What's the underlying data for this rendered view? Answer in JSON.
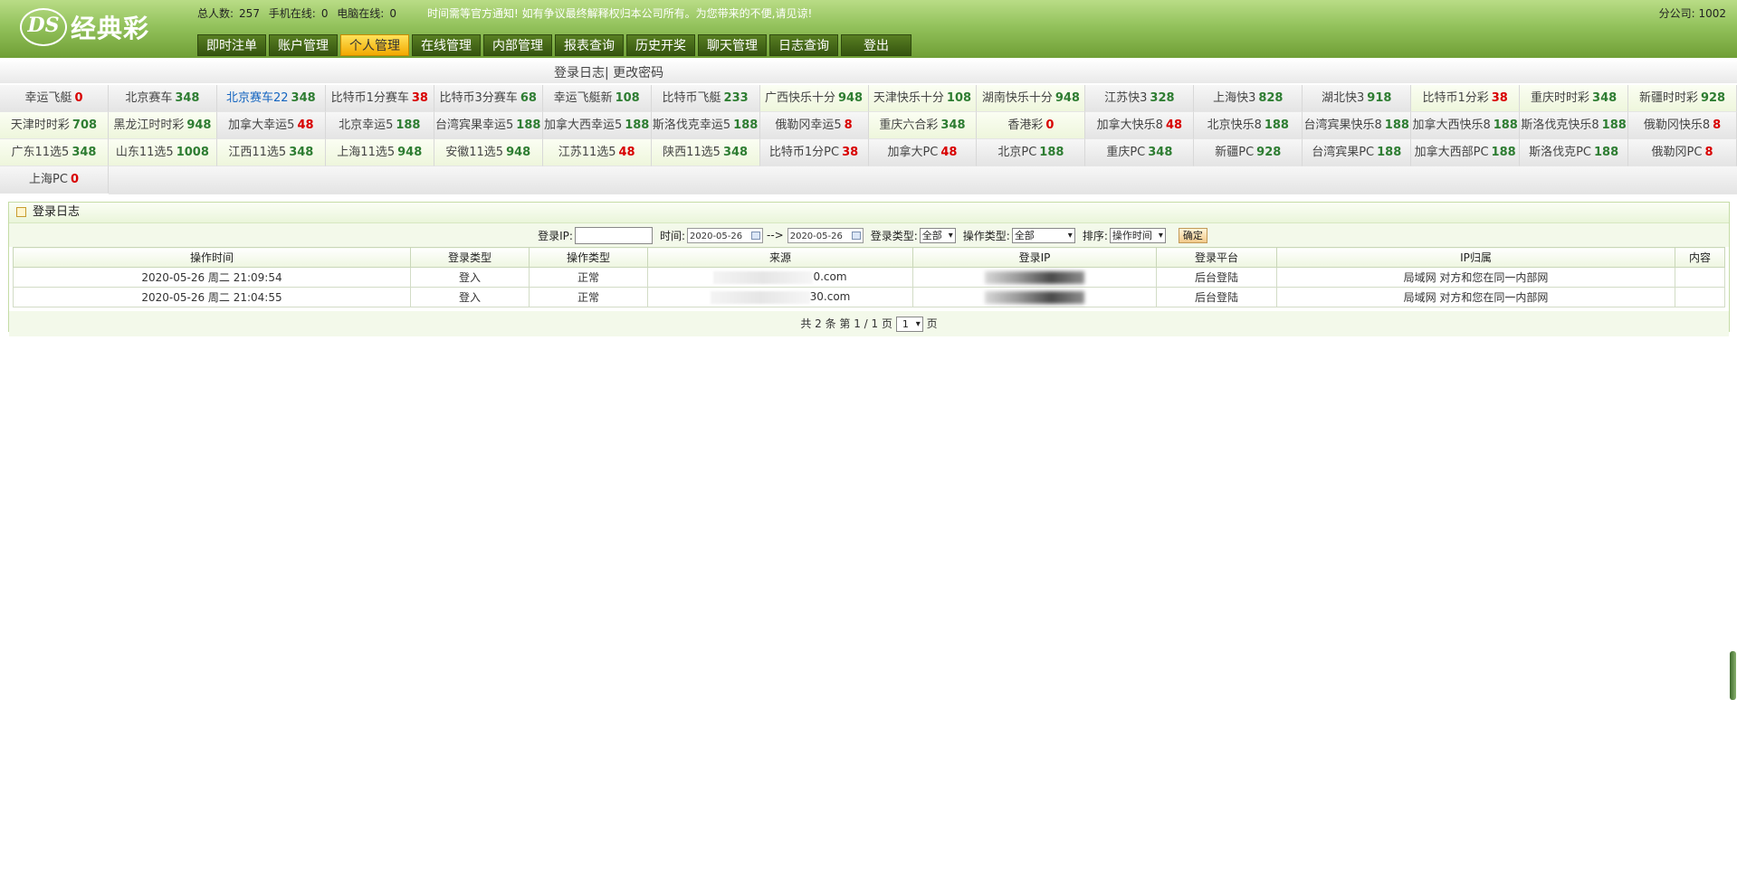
{
  "header": {
    "logo_mark": "DS",
    "logo_text": "经典彩",
    "stats": {
      "total_label": "总人数:",
      "total": "257",
      "mobile_label": "手机在线:",
      "mobile": "0",
      "pc_label": "电脑在线:",
      "pc": "0"
    },
    "notice": "时间需等官方通知! 如有争议最终解释权归本公司所有。为您带来的不便,请见谅!",
    "company": "分公司: 1002",
    "nav": [
      "即时注单",
      "账户管理",
      "个人管理",
      "在线管理",
      "内部管理",
      "报表查询",
      "历史开奖",
      "聊天管理",
      "日志查询",
      "登出"
    ],
    "active_nav": "个人管理"
  },
  "subnav": {
    "login_log": "登录日志",
    "sep": "|",
    "change_pwd": "更改密码"
  },
  "lottery": [
    [
      {
        "name": "幸运飞艇",
        "num": "0",
        "color": "red"
      },
      {
        "name": "北京赛车",
        "num": "348",
        "color": "green"
      },
      {
        "name": "北京赛车22",
        "num": "348",
        "color": "green",
        "name_color": "blue"
      },
      {
        "name": "比特币1分赛车",
        "num": "38",
        "color": "red"
      },
      {
        "name": "比特币3分赛车",
        "num": "68",
        "color": "green"
      },
      {
        "name": "幸运飞艇新",
        "num": "108",
        "color": "green"
      },
      {
        "name": "比特币飞艇",
        "num": "233",
        "color": "green"
      },
      {
        "name": "广西快乐十分",
        "num": "948",
        "color": "green",
        "bg": "g"
      },
      {
        "name": "天津快乐十分",
        "num": "108",
        "color": "green",
        "bg": "g"
      },
      {
        "name": "湖南快乐十分",
        "num": "948",
        "color": "green",
        "bg": "g"
      },
      {
        "name": "江苏快3",
        "num": "328",
        "color": "green"
      },
      {
        "name": "上海快3",
        "num": "828",
        "color": "green"
      },
      {
        "name": "湖北快3",
        "num": "918",
        "color": "green"
      },
      {
        "name": "比特币1分彩",
        "num": "38",
        "color": "red",
        "bg": "g"
      },
      {
        "name": "重庆时时彩",
        "num": "348",
        "color": "green",
        "bg": "g"
      },
      {
        "name": "新疆时时彩",
        "num": "928",
        "color": "green",
        "bg": "g"
      }
    ],
    [
      {
        "name": "天津时时彩",
        "num": "708",
        "color": "green",
        "bg": "g"
      },
      {
        "name": "黑龙江时时彩",
        "num": "948",
        "color": "green",
        "bg": "g"
      },
      {
        "name": "加拿大幸运5",
        "num": "48",
        "color": "red"
      },
      {
        "name": "北京幸运5",
        "num": "188",
        "color": "green"
      },
      {
        "name": "台湾宾果幸运5",
        "num": "188",
        "color": "green"
      },
      {
        "name": "加拿大西幸运5",
        "num": "188",
        "color": "green"
      },
      {
        "name": "斯洛伐克幸运5",
        "num": "188",
        "color": "green"
      },
      {
        "name": "俄勒冈幸运5",
        "num": "8",
        "color": "red"
      },
      {
        "name": "重庆六合彩",
        "num": "348",
        "color": "green",
        "bg": "g"
      },
      {
        "name": "香港彩",
        "num": "0",
        "color": "red",
        "bg": "g"
      },
      {
        "name": "加拿大快乐8",
        "num": "48",
        "color": "red"
      },
      {
        "name": "北京快乐8",
        "num": "188",
        "color": "green"
      },
      {
        "name": "台湾宾果快乐8",
        "num": "188",
        "color": "green"
      },
      {
        "name": "加拿大西快乐8",
        "num": "188",
        "color": "green"
      },
      {
        "name": "斯洛伐克快乐8",
        "num": "188",
        "color": "green"
      },
      {
        "name": "俄勒冈快乐8",
        "num": "8",
        "color": "red"
      }
    ],
    [
      {
        "name": "广东11选5",
        "num": "348",
        "color": "green",
        "bg": "g"
      },
      {
        "name": "山东11选5",
        "num": "1008",
        "color": "green",
        "bg": "g"
      },
      {
        "name": "江西11选5",
        "num": "348",
        "color": "green",
        "bg": "g"
      },
      {
        "name": "上海11选5",
        "num": "948",
        "color": "green",
        "bg": "g"
      },
      {
        "name": "安徽11选5",
        "num": "948",
        "color": "green",
        "bg": "g"
      },
      {
        "name": "江苏11选5",
        "num": "48",
        "color": "red",
        "bg": "g"
      },
      {
        "name": "陕西11选5",
        "num": "348",
        "color": "green",
        "bg": "g"
      },
      {
        "name": "比特币1分PC",
        "num": "38",
        "color": "red"
      },
      {
        "name": "加拿大PC",
        "num": "48",
        "color": "red"
      },
      {
        "name": "北京PC",
        "num": "188",
        "color": "green"
      },
      {
        "name": "重庆PC",
        "num": "348",
        "color": "green"
      },
      {
        "name": "新疆PC",
        "num": "928",
        "color": "green"
      },
      {
        "name": "台湾宾果PC",
        "num": "188",
        "color": "green"
      },
      {
        "name": "加拿大西部PC",
        "num": "188",
        "color": "green"
      },
      {
        "name": "斯洛伐克PC",
        "num": "188",
        "color": "green"
      },
      {
        "name": "俄勒冈PC",
        "num": "8",
        "color": "red"
      }
    ],
    [
      {
        "name": "上海PC",
        "num": "0",
        "color": "red"
      }
    ]
  ],
  "panel": {
    "title": "登录日志",
    "filter": {
      "ip_label": "登录IP:",
      "ip_value": "",
      "time_label": "时间:",
      "date_from": "2020-05-26",
      "arrow": "-->",
      "date_to": "2020-05-26",
      "login_type_label": "登录类型:",
      "login_type_value": "全部",
      "op_type_label": "操作类型:",
      "op_type_value": "全部",
      "sort_label": "排序:",
      "sort_value": "操作时间",
      "ok_label": "确定"
    },
    "table": {
      "headers": [
        "操作时间",
        "登录类型",
        "操作类型",
        "来源",
        "登录IP",
        "登录平台",
        "IP归属",
        "内容"
      ],
      "rows": [
        {
          "time": "2020-05-26 周二 21:09:54",
          "login_type": "登入",
          "op_type": "正常",
          "source_suffix": "0.com",
          "ip": "",
          "platform": "后台登陆",
          "location": "局域网 对方和您在同一内部网",
          "content": ""
        },
        {
          "time": "2020-05-26 周二 21:04:55",
          "login_type": "登入",
          "op_type": "正常",
          "source_suffix": "30.com",
          "ip": "",
          "platform": "后台登陆",
          "location": "局域网 对方和您在同一内部网",
          "content": ""
        }
      ]
    },
    "pager": {
      "prefix": "共 2 条 第 1 / 1 页",
      "page": "1",
      "suffix": "页"
    }
  },
  "colors": {
    "header_green": "#93c25c",
    "active_yellow": "#ffd21f",
    "num_green": "#2e7d32",
    "num_red": "#d80000"
  }
}
